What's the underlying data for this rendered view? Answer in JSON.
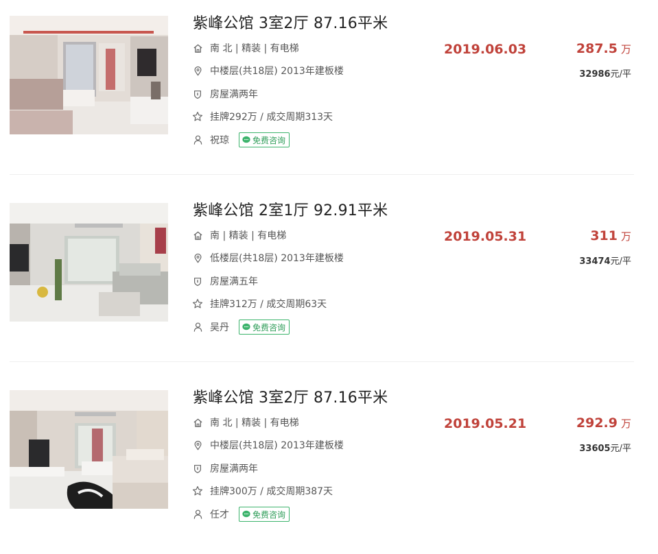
{
  "listings": [
    {
      "title": "紫峰公馆 3室2厅 87.16平米",
      "house_info": "南 北 | 精装 | 有电梯",
      "floor_info": "中楼层(共18层) 2013年建板楼",
      "tax_info": "房屋满两年",
      "deal_info": "挂牌292万 / 成交周期313天",
      "agent": "祝琼",
      "consult_label": "免费咨询",
      "deal_date": "2019.06.03",
      "total_price": "287.5",
      "total_price_unit": "万",
      "unit_price": "32986",
      "unit_price_suffix": "元/平"
    },
    {
      "title": "紫峰公馆 2室1厅 92.91平米",
      "house_info": "南 | 精装 | 有电梯",
      "floor_info": "低楼层(共18层) 2013年建板楼",
      "tax_info": "房屋满五年",
      "deal_info": "挂牌312万 / 成交周期63天",
      "agent": "吴丹",
      "consult_label": "免费咨询",
      "deal_date": "2019.05.31",
      "total_price": "311",
      "total_price_unit": "万",
      "unit_price": "33474",
      "unit_price_suffix": "元/平"
    },
    {
      "title": "紫峰公馆 3室2厅 87.16平米",
      "house_info": "南 北 | 精装 | 有电梯",
      "floor_info": "中楼层(共18层) 2013年建板楼",
      "tax_info": "房屋满两年",
      "deal_info": "挂牌300万 / 成交周期387天",
      "agent": "任才",
      "consult_label": "免费咨询",
      "deal_date": "2019.05.21",
      "total_price": "292.9",
      "total_price_unit": "万",
      "unit_price": "33605",
      "unit_price_suffix": "元/平"
    }
  ],
  "colors": {
    "price_red": "#c0423a",
    "consult_green": "#3bb36b",
    "icon_gray": "#666666"
  },
  "icons": [
    "house-icon",
    "location-pin-icon",
    "shield-icon",
    "star-icon",
    "person-icon",
    "chat-bubble-icon"
  ]
}
